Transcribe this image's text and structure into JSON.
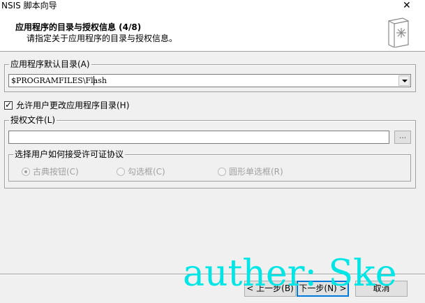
{
  "window": {
    "title": "NSIS 脚本向导",
    "close_glyph": "✕"
  },
  "header": {
    "title": "应用程序的目录与授权信息 (4/8)",
    "subtitle": "请指定关于应用程序的目录与授权信息。",
    "icon": "wizard-book-icon"
  },
  "install_dir": {
    "group_label": "应用程序默认目录(A)",
    "value": "$PROGRAMFILES\\Flash"
  },
  "allow_change": {
    "label": "允许用户更改应用程序目录(H)",
    "checked": true
  },
  "license": {
    "group_label": "授权文件(L)",
    "file_value": "",
    "browse_label": "...",
    "accept_group_label": "选择用户如何接受许可证协议",
    "options": [
      {
        "label": "古典按钮(C)",
        "checked": true
      },
      {
        "label": "勾选框(C)",
        "checked": false
      },
      {
        "label": "圆形单选框(R)",
        "checked": false
      }
    ]
  },
  "buttons": {
    "back": "< 上一步(B)",
    "next": "下一步(N) >",
    "cancel": "取消"
  },
  "watermark": "auther: Ske",
  "colors": {
    "accent": "#0078d7",
    "watermark": "#00e5e5"
  }
}
